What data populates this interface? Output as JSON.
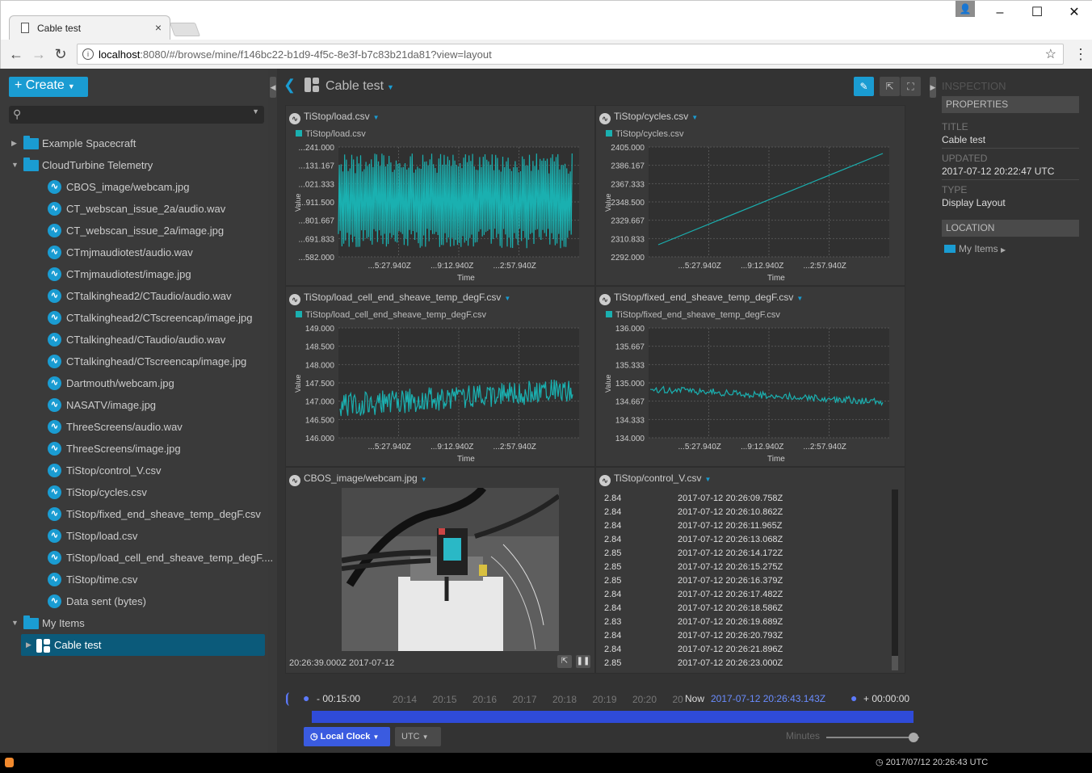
{
  "browser": {
    "tab_title": "Cable test",
    "url_host": "localhost",
    "url_rest": ":8080/#/browse/mine/f146bc22-b1d9-4f5c-8e3f-b7c83b21da81?view=layout"
  },
  "left": {
    "create_label": "Create",
    "tree": [
      {
        "label": "Example Spacecraft",
        "kind": "folder",
        "depth": 0,
        "arrow": "▶"
      },
      {
        "label": "CloudTurbine Telemetry",
        "kind": "folder",
        "depth": 0,
        "arrow": "▼"
      },
      {
        "label": "CBOS_image/webcam.jpg",
        "kind": "wave",
        "depth": 1
      },
      {
        "label": "CT_webscan_issue_2a/audio.wav",
        "kind": "wave",
        "depth": 1
      },
      {
        "label": "CT_webscan_issue_2a/image.jpg",
        "kind": "wave",
        "depth": 1
      },
      {
        "label": "CTmjmaudiotest/audio.wav",
        "kind": "wave",
        "depth": 1
      },
      {
        "label": "CTmjmaudiotest/image.jpg",
        "kind": "wave",
        "depth": 1
      },
      {
        "label": "CTtalkinghead2/CTaudio/audio.wav",
        "kind": "wave",
        "depth": 1
      },
      {
        "label": "CTtalkinghead2/CTscreencap/image.jpg",
        "kind": "wave",
        "depth": 1
      },
      {
        "label": "CTtalkinghead/CTaudio/audio.wav",
        "kind": "wave",
        "depth": 1
      },
      {
        "label": "CTtalkinghead/CTscreencap/image.jpg",
        "kind": "wave",
        "depth": 1
      },
      {
        "label": "Dartmouth/webcam.jpg",
        "kind": "wave",
        "depth": 1
      },
      {
        "label": "NASATV/image.jpg",
        "kind": "wave",
        "depth": 1
      },
      {
        "label": "ThreeScreens/audio.wav",
        "kind": "wave",
        "depth": 1
      },
      {
        "label": "ThreeScreens/image.jpg",
        "kind": "wave",
        "depth": 1
      },
      {
        "label": "TiStop/control_V.csv",
        "kind": "wave",
        "depth": 1
      },
      {
        "label": "TiStop/cycles.csv",
        "kind": "wave",
        "depth": 1
      },
      {
        "label": "TiStop/fixed_end_sheave_temp_degF.csv",
        "kind": "wave",
        "depth": 1
      },
      {
        "label": "TiStop/load.csv",
        "kind": "wave",
        "depth": 1
      },
      {
        "label": "TiStop/load_cell_end_sheave_temp_degF....",
        "kind": "wave",
        "depth": 1
      },
      {
        "label": "TiStop/time.csv",
        "kind": "wave",
        "depth": 1
      },
      {
        "label": "Data sent (bytes)",
        "kind": "wave",
        "depth": 1
      },
      {
        "label": "My Items",
        "kind": "folder",
        "depth": 0,
        "arrow": "▼"
      },
      {
        "label": "Cable test",
        "kind": "layout",
        "depth": 1,
        "arrow": "▶",
        "selected": true
      }
    ]
  },
  "center": {
    "title": "Cable test",
    "plots": [
      {
        "title": "TiStop/load.csv",
        "legend": "TiStop/load.csv",
        "yticks": [
          "...241.000",
          "...131.167",
          "...021.333",
          "...911.500",
          "...801.667",
          "...691.833",
          "...582.000"
        ],
        "xticks": [
          "...5:27.940Z",
          "...9:12.940Z",
          "...2:57.940Z"
        ],
        "xlabel": "Time",
        "ylabel": "Value"
      },
      {
        "title": "TiStop/cycles.csv",
        "legend": "TiStop/cycles.csv",
        "yticks": [
          "2405.000",
          "2386.167",
          "2367.333",
          "2348.500",
          "2329.667",
          "2310.833",
          "2292.000"
        ],
        "xticks": [
          "...5:27.940Z",
          "...9:12.940Z",
          "...2:57.940Z"
        ],
        "xlabel": "Time",
        "ylabel": "Value"
      },
      {
        "title": "TiStop/load_cell_end_sheave_temp_degF.csv",
        "legend": "TiStop/load_cell_end_sheave_temp_degF.csv",
        "yticks": [
          "149.000",
          "148.500",
          "148.000",
          "147.500",
          "147.000",
          "146.500",
          "146.000"
        ],
        "xticks": [
          "...5:27.940Z",
          "...9:12.940Z",
          "...2:57.940Z"
        ],
        "xlabel": "Time",
        "ylabel": "Value"
      },
      {
        "title": "TiStop/fixed_end_sheave_temp_degF.csv",
        "legend": "TiStop/fixed_end_sheave_temp_degF.csv",
        "yticks": [
          "136.000",
          "135.667",
          "135.333",
          "135.000",
          "134.667",
          "134.333",
          "134.000"
        ],
        "xticks": [
          "...5:27.940Z",
          "...9:12.940Z",
          "...2:57.940Z"
        ],
        "xlabel": "Time",
        "ylabel": "Value"
      }
    ],
    "image": {
      "title": "CBOS_image/webcam.jpg",
      "timestamp": "20:26:39.000Z 2017-07-12"
    },
    "table": {
      "title": "TiStop/control_V.csv",
      "rows": [
        [
          "2.84",
          "2017-07-12 20:26:09.758Z"
        ],
        [
          "2.84",
          "2017-07-12 20:26:10.862Z"
        ],
        [
          "2.84",
          "2017-07-12 20:26:11.965Z"
        ],
        [
          "2.84",
          "2017-07-12 20:26:13.068Z"
        ],
        [
          "2.85",
          "2017-07-12 20:26:14.172Z"
        ],
        [
          "2.85",
          "2017-07-12 20:26:15.275Z"
        ],
        [
          "2.85",
          "2017-07-12 20:26:16.379Z"
        ],
        [
          "2.84",
          "2017-07-12 20:26:17.482Z"
        ],
        [
          "2.84",
          "2017-07-12 20:26:18.586Z"
        ],
        [
          "2.83",
          "2017-07-12 20:26:19.689Z"
        ],
        [
          "2.84",
          "2017-07-12 20:26:20.793Z"
        ],
        [
          "2.84",
          "2017-07-12 20:26:21.896Z"
        ],
        [
          "2.85",
          "2017-07-12 20:26:23.000Z"
        ]
      ]
    }
  },
  "time": {
    "start_delta": "- 00:15:00",
    "ticks": [
      "20:14",
      "20:15",
      "20:16",
      "20:17",
      "20:18",
      "20:19",
      "20:20",
      "20"
    ],
    "now_label": "Now",
    "now_value": "2017-07-12 20:26:43.143Z",
    "end_delta": "+ 00:00:00",
    "clock_label": "Local Clock",
    "tz_label": "UTC",
    "zoom_label": "Minutes",
    "zoom_level": 0.9
  },
  "inspector": {
    "header": "INSPECTION",
    "properties": "PROPERTIES",
    "title_label": "TITLE",
    "title_value": "Cable test",
    "updated_label": "UPDATED",
    "updated_value": "2017-07-12 20:22:47 UTC",
    "type_label": "TYPE",
    "type_value": "Display Layout",
    "location": "LOCATION",
    "location_value": "My Items"
  },
  "status": {
    "clock": "2017/07/12 20:26:43 UTC"
  }
}
